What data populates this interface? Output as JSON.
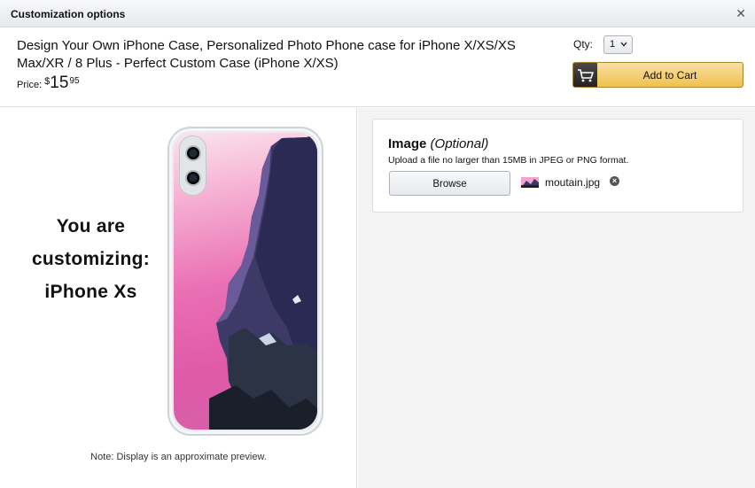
{
  "dialog": {
    "title": "Customization options",
    "close_icon": "close-icon"
  },
  "product": {
    "title": "Design Your Own iPhone Case, Personalized Photo Phone case for iPhone X/XS/XS Max/XR / 8 Plus - Perfect Custom Case (iPhone X/XS)",
    "price_label": "Price:",
    "price_currency": "$",
    "price_whole": "15",
    "price_fraction": "95"
  },
  "purchase": {
    "qty_label": "Qty:",
    "qty_value": "1",
    "add_to_cart_label": "Add to Cart",
    "cart_icon": "shopping-cart-icon"
  },
  "preview": {
    "line1": "You are",
    "line2": "customizing:",
    "line3": "iPhone Xs",
    "note": "Note: Display is an approximate preview."
  },
  "image_option": {
    "heading": "Image",
    "optional_label": "(Optional)",
    "hint": "Upload a file no larger than 15MB in JPEG or PNG format.",
    "browse_label": "Browse",
    "file_name": "moutain.jpg",
    "remove_icon": "remove-file-icon"
  },
  "colors": {
    "cart_button": "#f0c14b",
    "cart_button_border": "#a88734"
  }
}
